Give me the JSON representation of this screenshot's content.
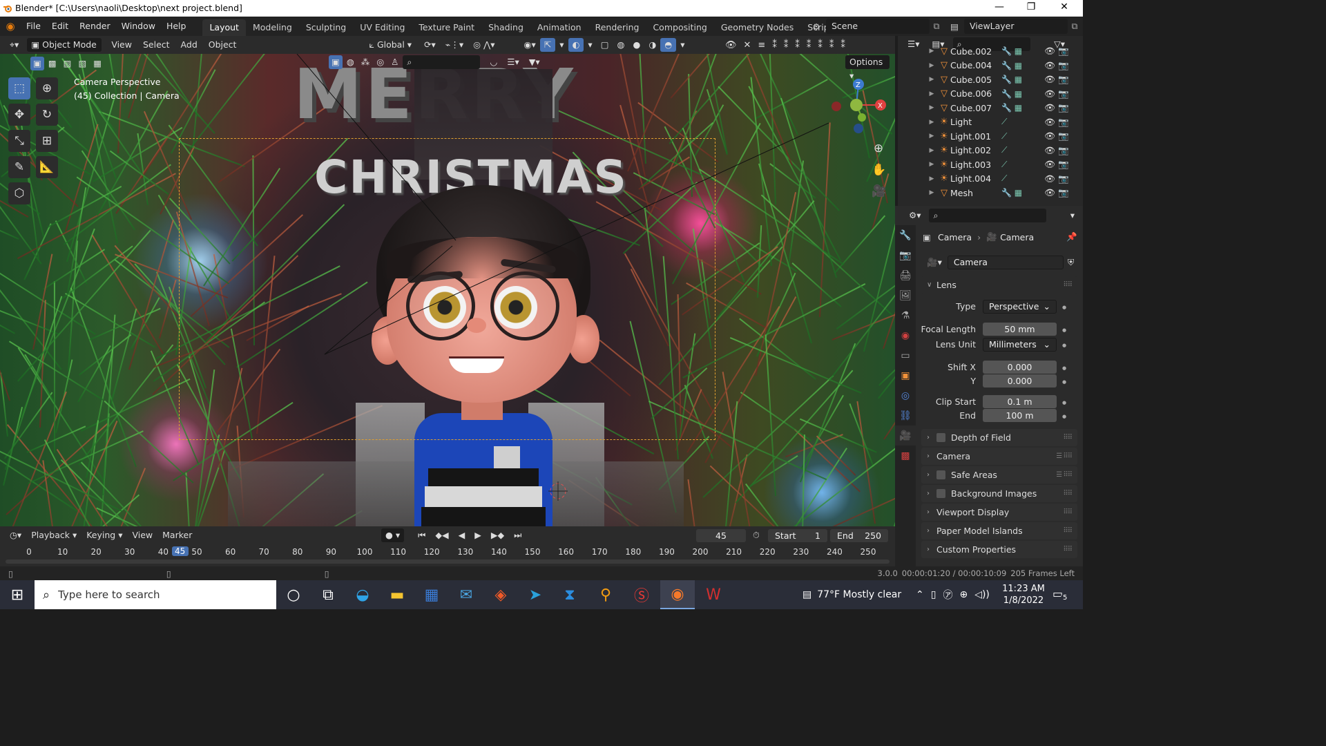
{
  "window": {
    "title": "Blender* [C:\\Users\\naoli\\Desktop\\next project.blend]",
    "minimize": "—",
    "maximize": "❐",
    "close": "✕"
  },
  "menu": [
    "File",
    "Edit",
    "Render",
    "Window",
    "Help"
  ],
  "workspaces": [
    "Layout",
    "Modeling",
    "Sculpting",
    "UV Editing",
    "Texture Paint",
    "Shading",
    "Animation",
    "Rendering",
    "Compositing",
    "Geometry Nodes",
    "Scripting"
  ],
  "add_workspace": "+",
  "scene": "Scene",
  "view_layer": "ViewLayer",
  "viewport_header": {
    "mode": "Object Mode",
    "view": "View",
    "select": "Select",
    "add": "Add",
    "object": "Object",
    "orientation": "Global",
    "options": "Options"
  },
  "viewport": {
    "perspective": "Camera Perspective",
    "collection": "(45) Collection | Camera",
    "text_merry": "MERRY",
    "text_christmas": "CHRISTMAS"
  },
  "outliner": {
    "items": [
      {
        "name": "Cube.002",
        "type": "mesh"
      },
      {
        "name": "Cube.004",
        "type": "mesh"
      },
      {
        "name": "Cube.005",
        "type": "mesh"
      },
      {
        "name": "Cube.006",
        "type": "mesh"
      },
      {
        "name": "Cube.007",
        "type": "mesh"
      },
      {
        "name": "Light",
        "type": "light"
      },
      {
        "name": "Light.001",
        "type": "light"
      },
      {
        "name": "Light.002",
        "type": "light"
      },
      {
        "name": "Light.003",
        "type": "light"
      },
      {
        "name": "Light.004",
        "type": "light"
      },
      {
        "name": "Mesh",
        "type": "mesh"
      }
    ]
  },
  "properties": {
    "breadcrumb_object": "Camera",
    "breadcrumb_data": "Camera",
    "datablock": "Camera",
    "lens_panel": "Lens",
    "type_label": "Type",
    "type_value": "Perspective",
    "focal_label": "Focal Length",
    "focal_value": "50 mm",
    "lens_unit_label": "Lens Unit",
    "lens_unit_value": "Millimeters",
    "shiftx_label": "Shift X",
    "shiftx_value": "0.000",
    "shifty_label": "Y",
    "shifty_value": "0.000",
    "clipstart_label": "Clip Start",
    "clipstart_value": "0.1 m",
    "clipend_label": "End",
    "clipend_value": "100 m",
    "panels": [
      "Depth of Field",
      "Camera",
      "Safe Areas",
      "Background Images",
      "Viewport Display",
      "Paper Model Islands",
      "Custom Properties"
    ]
  },
  "timeline": {
    "playback": "Playback",
    "keying": "Keying",
    "view": "View",
    "marker": "Marker",
    "current_frame": "45",
    "start_label": "Start",
    "start_value": "1",
    "end_label": "End",
    "end_value": "250",
    "ticks": [
      "0",
      "10",
      "20",
      "30",
      "40",
      "45",
      "50",
      "60",
      "70",
      "80",
      "90",
      "100",
      "110",
      "120",
      "130",
      "140",
      "150",
      "160",
      "170",
      "180",
      "190",
      "200",
      "210",
      "220",
      "230",
      "240",
      "250"
    ]
  },
  "status": {
    "version": "3.0.0",
    "time": "00:00:01:20 / 00:00:10:09",
    "frames_left": "205 Frames Left"
  },
  "taskbar": {
    "search_placeholder": "Type here to search",
    "weather": "77°F  Mostly clear",
    "time": "11:23 AM",
    "date": "1/8/2022",
    "notifications": "5"
  },
  "colors": {
    "accent": "#4772b3",
    "camera_frame": "#e0a030",
    "active_frame": "#3d7bd1"
  }
}
